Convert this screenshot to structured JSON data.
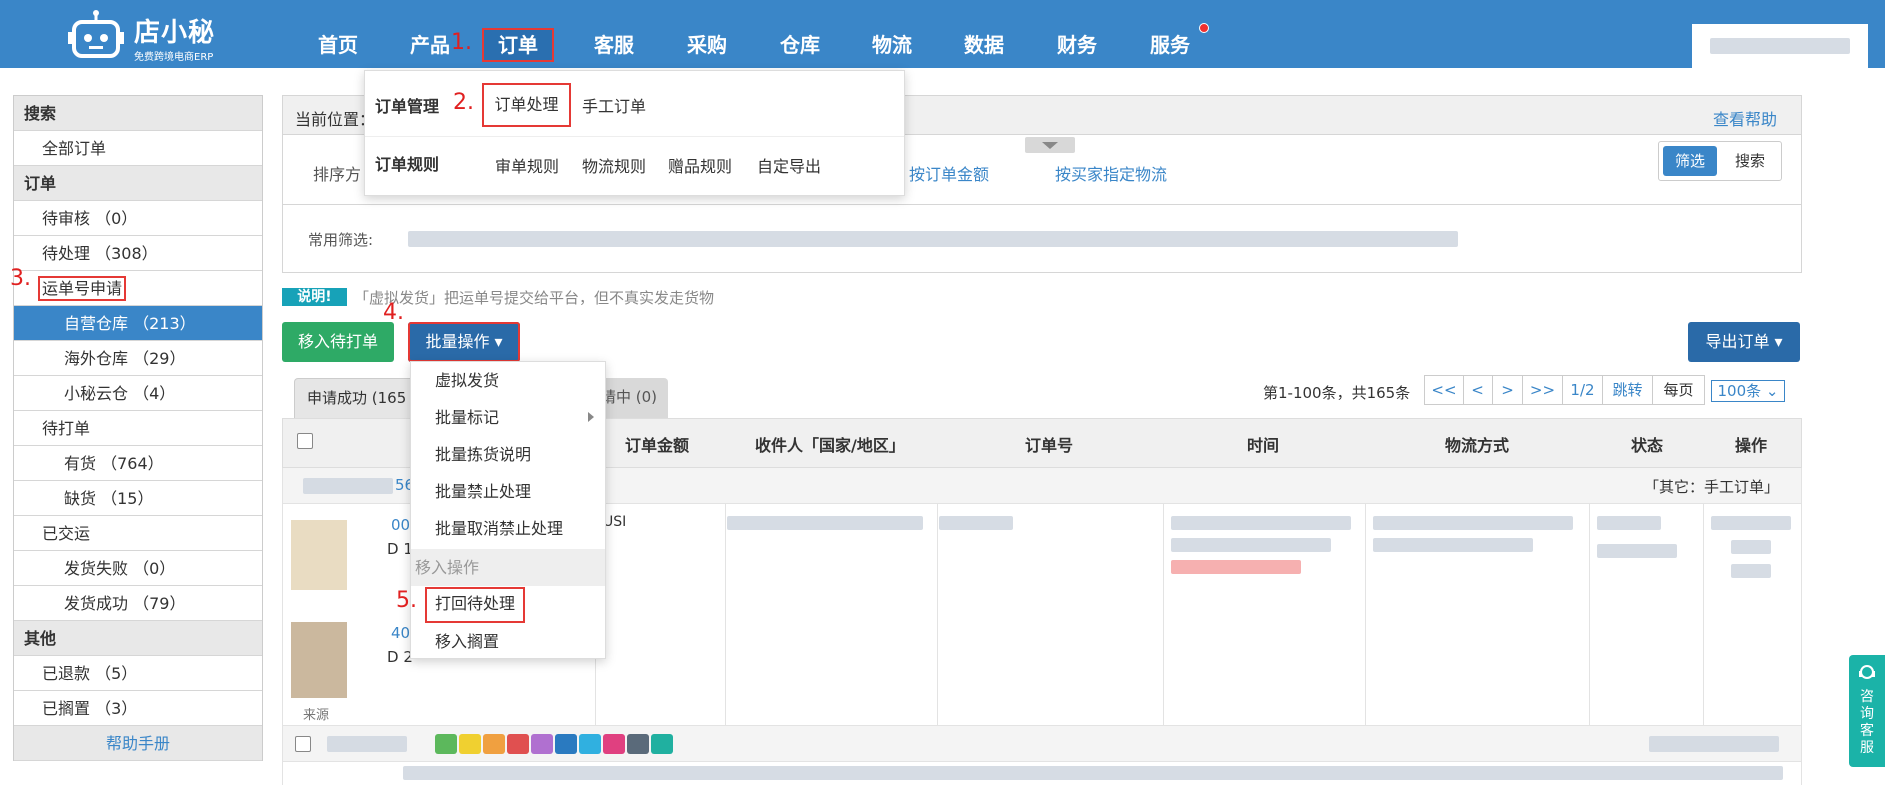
{
  "header": {
    "brand": "店小秘",
    "tagline": "免费跨境电商ERP",
    "nav": [
      "首页",
      "产品",
      "订单",
      "客服",
      "采购",
      "仓库",
      "物流",
      "数据",
      "财务",
      "服务"
    ],
    "active_nav": "订单"
  },
  "steps": [
    "1.",
    "2.",
    "3.",
    "4.",
    "5."
  ],
  "mega_menu": {
    "row1_label": "订单管理",
    "row1_items": [
      "订单处理",
      "手工订单"
    ],
    "row2_label": "订单规则",
    "row2_items": [
      "审单规则",
      "物流规则",
      "赠品规则",
      "自定导出"
    ]
  },
  "sidebar": {
    "search": "搜索",
    "all_orders": "全部订单",
    "orders": "订单",
    "pending_review": "待审核 （0）",
    "pending_process": "待处理 （308）",
    "waybill_apply": "运单号申请",
    "self_warehouse": "自营仓库 （213）",
    "overseas_warehouse": "海外仓库 （29）",
    "xiaomi_cloud": "小秘云仓 （4）",
    "to_print": "待打单",
    "in_stock": "有货 （764）",
    "out_of_stock": "缺货 （15）",
    "shipped": "已交运",
    "ship_failed": "发货失败 （0）",
    "ship_success": "发货成功 （79）",
    "other": "其他",
    "refunded": "已退款 （5）",
    "shelved": "已搁置 （3）",
    "help_manual": "帮助手册"
  },
  "main": {
    "breadcrumb": "当前位置：",
    "help_link": "查看帮助",
    "sort_label": "排序方",
    "sort_amount": "按订单金额",
    "sort_buyer_logistics": "按买家指定物流",
    "filter_btn": "筛选",
    "search_btn": "搜索",
    "common_filter": "常用筛选:",
    "notice_badge": "说明!",
    "notice_text": "「虚拟发货」把运单号提交给平台，但不真实发走货物",
    "move_to_print": "移入待打单",
    "batch_ops": "批量操作 ▾",
    "export_orders": "导出订单 ▾",
    "tab_success": "申请成功 (165",
    "tab_pending": "请中 (0)",
    "page_info": "第1-100条，共165条",
    "pager": [
      "<<",
      "<",
      ">",
      ">>",
      "1/2",
      "跳转"
    ],
    "per_page": "每页",
    "per_page_value": "100条",
    "columns": [
      "订单金额",
      "收件人「国家/地区」",
      "订单号",
      "时间",
      "物流方式",
      "状态",
      "操作"
    ],
    "other_tag": "「其它：手工订单」",
    "source_label": "来源",
    "partial_text": [
      "56",
      "00",
      "D 1",
      "40",
      "D 2",
      "USI"
    ]
  },
  "batch_menu": {
    "items": [
      "虚拟发货",
      "批量标记",
      "批量拣货说明",
      "批量禁止处理",
      "批量取消禁止处理"
    ],
    "section": "移入操作",
    "move_items": [
      "打回待处理",
      "移入搁置"
    ]
  },
  "side_service": "咨询客服"
}
